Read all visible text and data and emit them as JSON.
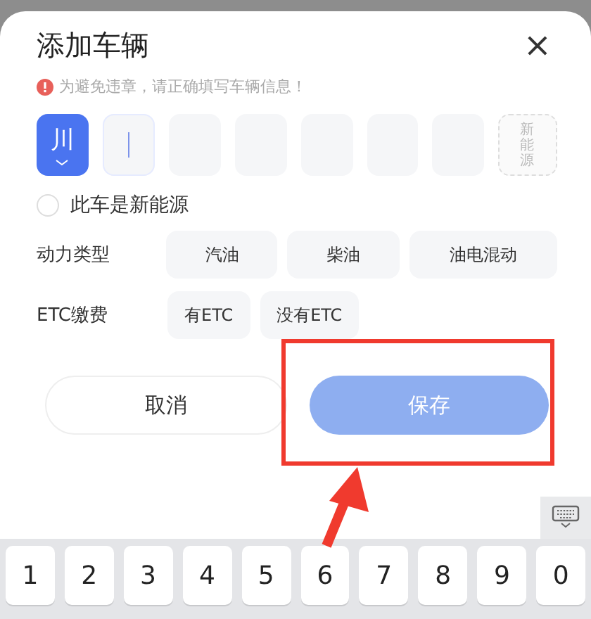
{
  "dialog": {
    "title": "添加车辆",
    "close_icon": "×",
    "warning": "为避免违章，请正确填写车辆信息！"
  },
  "plate": {
    "slots": [
      {
        "kind": "province",
        "value": "川",
        "selected": false
      },
      {
        "kind": "char",
        "selected": true
      },
      {
        "kind": "char",
        "selected": false
      },
      {
        "kind": "char",
        "selected": false
      },
      {
        "kind": "char",
        "selected": false
      },
      {
        "kind": "char",
        "selected": false
      },
      {
        "kind": "char",
        "selected": false
      },
      {
        "kind": "new_energy",
        "value": "新能源",
        "selected": false
      }
    ]
  },
  "new_energy_checkbox": {
    "label": "此车是新能源",
    "checked": false
  },
  "options": [
    {
      "label": "动力类型",
      "choices": [
        {
          "label": "汽油",
          "selected": false
        },
        {
          "label": "柴油",
          "selected": false
        },
        {
          "label": "油电混动",
          "selected": false
        }
      ]
    },
    {
      "label": "ETC缴费",
      "choices": [
        {
          "label": "有ETC",
          "selected": false
        },
        {
          "label": "没有ETC",
          "selected": false
        }
      ]
    }
  ],
  "buttons": [
    {
      "kind": "secondary",
      "label": "取消",
      "disabled": false
    },
    {
      "kind": "primary",
      "label": "保存",
      "disabled": true
    }
  ],
  "keyboard": {
    "keys": [
      "1",
      "2",
      "3",
      "4",
      "5",
      "6",
      "7",
      "8",
      "9",
      "0"
    ]
  }
}
